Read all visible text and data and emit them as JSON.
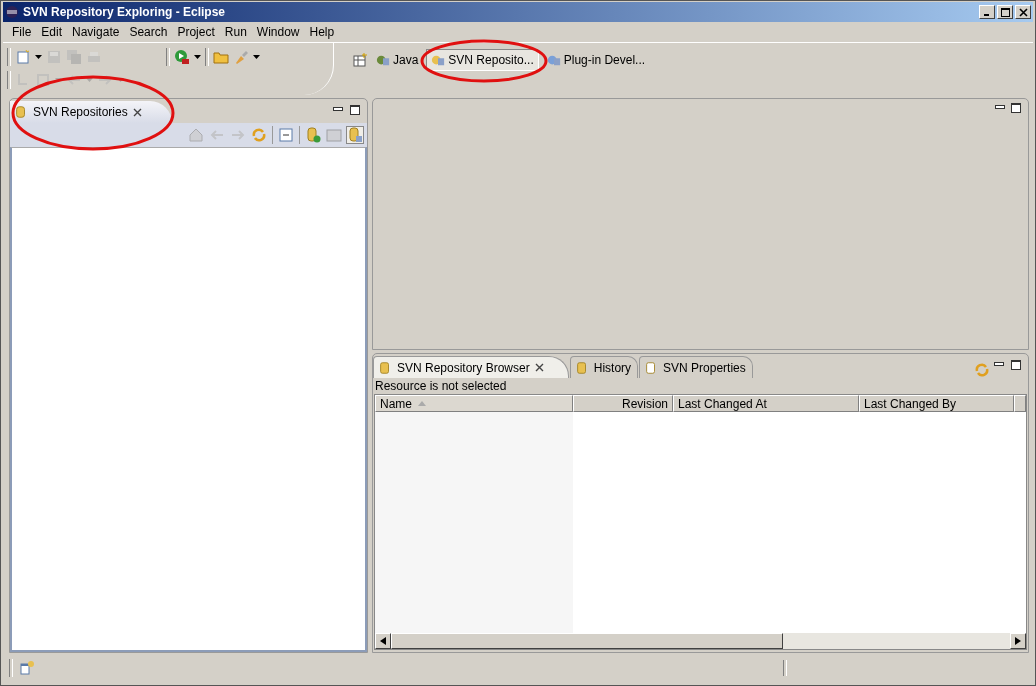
{
  "window": {
    "title": "SVN Repository Exploring - Eclipse"
  },
  "menu": [
    "File",
    "Edit",
    "Navigate",
    "Search",
    "Project",
    "Run",
    "Window",
    "Help"
  ],
  "perspectives": [
    {
      "label": "Java",
      "selected": false
    },
    {
      "label": "SVN Reposito...",
      "selected": true
    },
    {
      "label": "Plug-in Devel...",
      "selected": false
    }
  ],
  "left_view": {
    "tab": {
      "label": "SVN Repositories",
      "selected": true
    }
  },
  "bottom_view": {
    "tabs": [
      {
        "label": "SVN Repository Browser",
        "selected": true,
        "closable": true
      },
      {
        "label": "History",
        "selected": false,
        "closable": false
      },
      {
        "label": "SVN Properties",
        "selected": false,
        "closable": false
      }
    ],
    "message": "Resource is not selected",
    "columns": [
      {
        "label": "Name",
        "sorted": true
      },
      {
        "label": "Revision",
        "sorted": false
      },
      {
        "label": "Last Changed At",
        "sorted": false
      },
      {
        "label": "Last Changed By",
        "sorted": false
      }
    ]
  }
}
